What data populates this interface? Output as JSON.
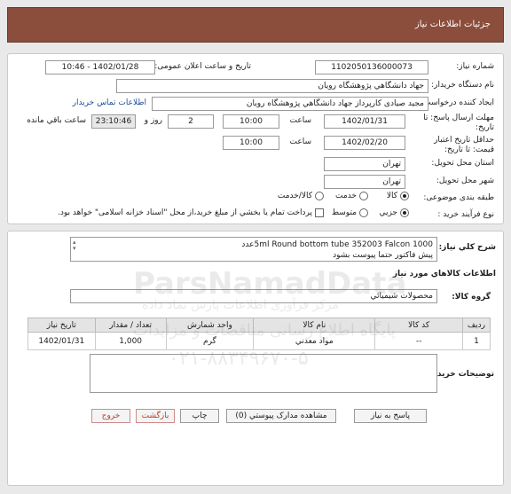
{
  "header": {
    "title": "جزئيات اطلاعات نياز"
  },
  "labels": {
    "need_number": "شماره نياز:",
    "announce_date": "تاريخ و ساعت اعلان عمومی:",
    "buyer_org": "نام دستگاه خريدار:",
    "creator": "ايجاد کننده درخواست:",
    "deadline_send": "مهلت ارسال پاسخ: تا",
    "date_suffix": "تاريخ:",
    "time": "ساعت",
    "days": "روز و",
    "remaining": "ساعت باقي مانده",
    "min_validity": "حداقل تاريخ اعتبار",
    "price_until": "قيمت: تا تاريخ:",
    "province": "استان محل تحويل:",
    "city": "شهر محل تحويل:",
    "category": "طبقه بندی موضوعی:",
    "process": "نوع فرآيند خريد :"
  },
  "fields": {
    "need_number": "1102050136000073",
    "announce_datetime": "1402/01/28 - 10:46",
    "buyer_org": "جهاد دانشگاهي پژوهشگاه رويان",
    "creator": "مجيد صيادی کارپرداز جهاد دانشگاهي پژوهشگاه رويان",
    "buyer_contact_link": "اطلاعات تماس خريدار",
    "deadline_date": "1402/01/31",
    "deadline_time": "10:00",
    "remaining_days": "2",
    "remaining_time": "23:10:46",
    "validity_date": "1402/02/20",
    "validity_time": "10:00",
    "province": "تهران",
    "city": "تهران"
  },
  "category_options": [
    {
      "label": "کالا",
      "selected": true
    },
    {
      "label": "خدمت",
      "selected": false
    },
    {
      "label": "کالا/خدمت",
      "selected": false
    }
  ],
  "process_options": [
    {
      "label": "جزيي",
      "selected": true
    },
    {
      "label": "متوسط",
      "selected": false
    }
  ],
  "process_note": "پرداخت تمام يا بخشي از مبلغ خريد،از محل \"اسناد خزانه اسلامی\" خواهد بود.",
  "description": {
    "label": "شرح کلي نياز:",
    "line1": "5ml Round bottom tube 352003 Falcon  1000عدد",
    "line2": "پيش فاکتور حتما پيوست بشود"
  },
  "goods": {
    "section_title": "اطلاعات کالاهاي مورد نياز",
    "group_label": "گروه کالا:",
    "group_value": "محصولات شيميائي",
    "columns": [
      "رديف",
      "کد کالا",
      "نام کالا",
      "واحد شمارش",
      "تعداد / مقدار",
      "تاريخ نياز"
    ],
    "rows": [
      [
        "1",
        "--",
        "مواد معدني",
        "گرم",
        "1,000",
        "1402/01/31"
      ]
    ]
  },
  "buyer_notes_label": "توضيحات خريدار:",
  "buttons": {
    "reply": "پاسخ به نياز",
    "attachments": "مشاهده مدارک پيوستي (0)",
    "print": "چاپ",
    "back": "بازگشت",
    "exit": "خروج"
  },
  "watermark": {
    "brand": "ParsNamadData",
    "line1": "مرکز فرآوری اطلاعات پارس نماد داده",
    "line2": "پایگاه اطلاع رسانی مناقصات و مزایدات",
    "phone": "۰۲۱-۸۸۳۴۹۶۷۰-۵"
  },
  "colors": {
    "header_bg": "#8b4d3c",
    "link": "#1a4c9c",
    "exit_text": "#c0392b"
  }
}
